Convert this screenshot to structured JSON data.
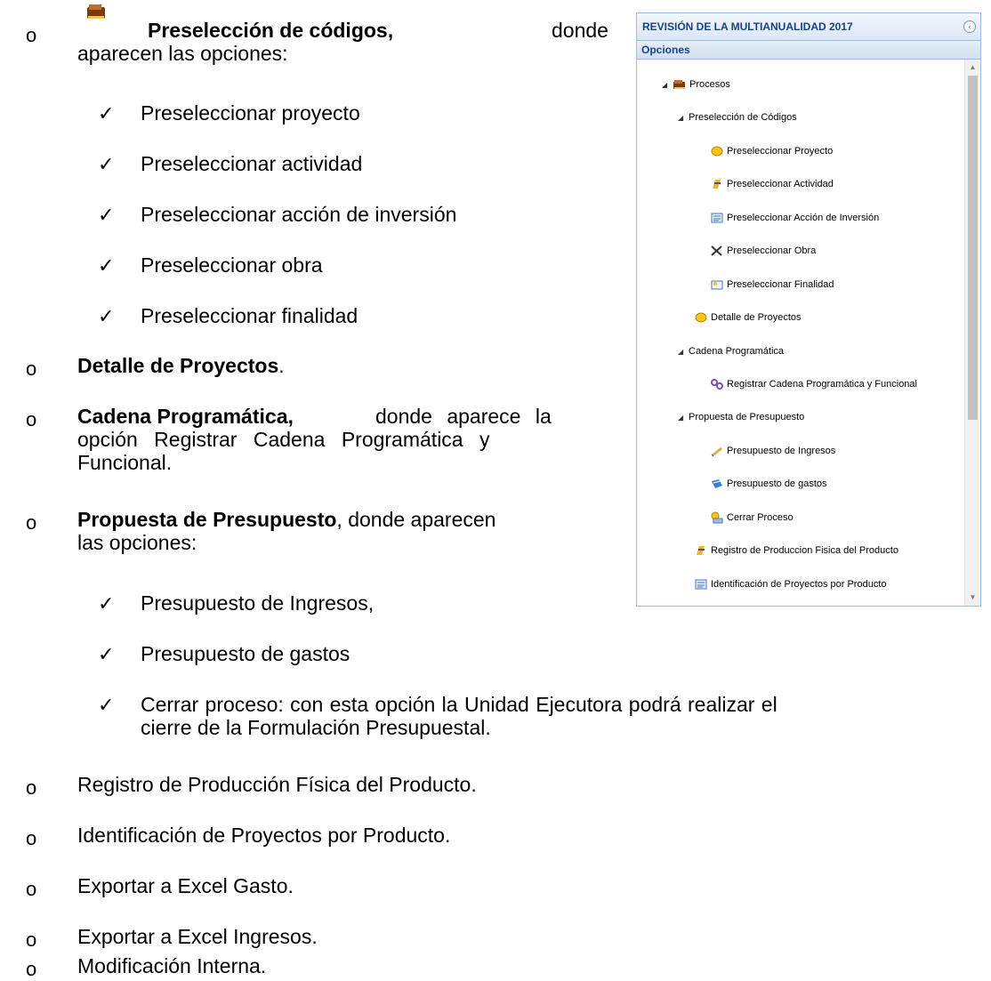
{
  "doc": {
    "preseleccion": {
      "bold": "Preselección de códigos,",
      "rest1": "donde",
      "rest2": "aparecen las opciones:"
    },
    "pre_options": [
      "Preseleccionar proyecto",
      "Preseleccionar actividad",
      "Preseleccionar acción de inversión",
      "Preseleccionar obra",
      "Preseleccionar finalidad"
    ],
    "detalle": {
      "bold": "Detalle de Proyectos",
      "rest": "."
    },
    "cadena": {
      "bold": "Cadena Programática,",
      "line1_rest": "donde aparece la",
      "line2": "opción Registrar Cadena Programática y",
      "line3": "Funcional."
    },
    "propuesta": {
      "bold": "Propuesta de Presupuesto",
      "line1_rest": ", donde aparecen",
      "line2": "las opciones:"
    },
    "prop_options": [
      "Presupuesto de Ingresos,",
      "Presupuesto de gastos"
    ],
    "cerrar": {
      "line1": "Cerrar proceso: con esta opción la Unidad Ejecutora podrá realizar el",
      "line2": "cierre de la Formulación Presupuestal."
    },
    "others": [
      "Registro de Producción Física del Producto.",
      "Identificación de Proyectos por Producto.",
      "Exportar a Excel Gasto.",
      "Exportar a Excel Ingresos.",
      "Modificación Interna."
    ],
    "bullet": "o",
    "check": "✓"
  },
  "panel": {
    "title": "REVISIÓN DE LA MULTIANUALIDAD 2017",
    "section": "Opciones",
    "tree": [
      {
        "label": "Procesos",
        "icon": "folder-book-icon"
      },
      {
        "label": "Preselección de Códigos",
        "icon": ""
      },
      {
        "label": "Preseleccionar Proyecto",
        "icon": "project-icon"
      },
      {
        "label": "Preseleccionar Actividad",
        "icon": "activity-icon"
      },
      {
        "label": "Preseleccionar Acción de Inversión",
        "icon": "investment-icon"
      },
      {
        "label": "Preseleccionar Obra",
        "icon": "tools-icon"
      },
      {
        "label": "Preseleccionar Finalidad",
        "icon": "finalidad-icon"
      },
      {
        "label": "Detalle de Proyectos",
        "icon": "project-icon"
      },
      {
        "label": "Cadena Programática",
        "icon": ""
      },
      {
        "label": "Registrar Cadena Programática y Funcional",
        "icon": "chain-icon"
      },
      {
        "label": "Propuesta de Presupuesto",
        "icon": ""
      },
      {
        "label": "Presupuesto de Ingresos",
        "icon": "income-icon"
      },
      {
        "label": "Presupuesto de gastos",
        "icon": "expense-icon"
      },
      {
        "label": "Cerrar Proceso",
        "icon": "close-process-icon"
      },
      {
        "label": "Registro de Produccion Fisica del Producto",
        "icon": "activity-icon"
      },
      {
        "label": "Identificación de Proyectos por Producto",
        "icon": "investment-icon"
      }
    ]
  }
}
